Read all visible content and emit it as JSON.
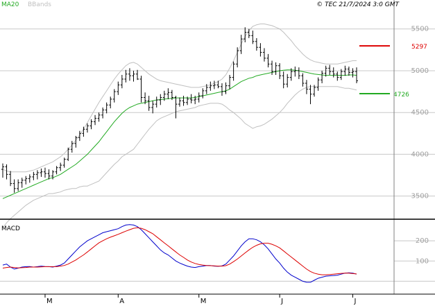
{
  "header": {
    "legend_ma": "MA20",
    "legend_bb": "BBands",
    "copyright": "© TEC 21/7/2024 3:0 GMT"
  },
  "colors": {
    "ma20": "#22aa22",
    "bbands": "#c0c0c0",
    "price_bars": "#000000",
    "macd": "#0000cc",
    "signal": "#dd0000",
    "resistance": "#dd0000",
    "support": "#22aa22",
    "grid": "#c8c8c8"
  },
  "levels": {
    "resistance": {
      "value": 5297,
      "label": "5297"
    },
    "support": {
      "value": 4726,
      "label": "4726"
    }
  },
  "macd_label": "MACD",
  "chart_data": [
    {
      "type": "ohlc",
      "panel": "price",
      "y_ticks": [
        3500,
        4000,
        4500,
        5000,
        5500
      ],
      "ylim": [
        3240,
        5730
      ],
      "x_ticks": [
        {
          "index": 11,
          "label": "M"
        },
        {
          "index": 30,
          "label": "A"
        },
        {
          "index": 51,
          "label": "M"
        },
        {
          "index": 72,
          "label": "J"
        },
        {
          "index": 91,
          "label": "J"
        }
      ],
      "ohlc": [
        [
          3820,
          3890,
          3720,
          3850
        ],
        [
          3850,
          3880,
          3700,
          3760
        ],
        [
          3760,
          3800,
          3620,
          3650
        ],
        [
          3650,
          3700,
          3540,
          3590
        ],
        [
          3590,
          3700,
          3560,
          3660
        ],
        [
          3660,
          3720,
          3600,
          3690
        ],
        [
          3690,
          3740,
          3640,
          3710
        ],
        [
          3710,
          3760,
          3660,
          3730
        ],
        [
          3730,
          3790,
          3690,
          3760
        ],
        [
          3760,
          3810,
          3700,
          3780
        ],
        [
          3780,
          3830,
          3730,
          3790
        ],
        [
          3790,
          3840,
          3720,
          3770
        ],
        [
          3770,
          3820,
          3700,
          3740
        ],
        [
          3740,
          3810,
          3700,
          3790
        ],
        [
          3790,
          3860,
          3760,
          3840
        ],
        [
          3840,
          3900,
          3800,
          3870
        ],
        [
          3870,
          3960,
          3840,
          3940
        ],
        [
          3940,
          4080,
          3920,
          4060
        ],
        [
          4060,
          4160,
          4020,
          4130
        ],
        [
          4130,
          4220,
          4080,
          4200
        ],
        [
          4200,
          4280,
          4160,
          4250
        ],
        [
          4250,
          4330,
          4210,
          4300
        ],
        [
          4300,
          4370,
          4260,
          4340
        ],
        [
          4340,
          4420,
          4300,
          4390
        ],
        [
          4390,
          4470,
          4350,
          4430
        ],
        [
          4430,
          4500,
          4390,
          4470
        ],
        [
          4470,
          4560,
          4430,
          4530
        ],
        [
          4530,
          4620,
          4490,
          4590
        ],
        [
          4590,
          4690,
          4550,
          4660
        ],
        [
          4660,
          4780,
          4620,
          4750
        ],
        [
          4750,
          4870,
          4710,
          4830
        ],
        [
          4830,
          4950,
          4790,
          4900
        ],
        [
          4900,
          5010,
          4860,
          4960
        ],
        [
          4960,
          5030,
          4880,
          4940
        ],
        [
          4940,
          5000,
          4870,
          4960
        ],
        [
          4960,
          5010,
          4890,
          4900
        ],
        [
          4900,
          4940,
          4620,
          4680
        ],
        [
          4680,
          4740,
          4600,
          4640
        ],
        [
          4640,
          4700,
          4520,
          4560
        ],
        [
          4560,
          4640,
          4490,
          4600
        ],
        [
          4600,
          4690,
          4560,
          4650
        ],
        [
          4650,
          4720,
          4590,
          4680
        ],
        [
          4680,
          4760,
          4640,
          4720
        ],
        [
          4720,
          4790,
          4660,
          4740
        ],
        [
          4740,
          4770,
          4650,
          4680
        ],
        [
          4680,
          4700,
          4430,
          4600
        ],
        [
          4600,
          4680,
          4570,
          4640
        ],
        [
          4640,
          4700,
          4580,
          4620
        ],
        [
          4620,
          4690,
          4590,
          4660
        ],
        [
          4660,
          4720,
          4610,
          4650
        ],
        [
          4650,
          4700,
          4600,
          4660
        ],
        [
          4660,
          4740,
          4620,
          4700
        ],
        [
          4700,
          4790,
          4670,
          4760
        ],
        [
          4760,
          4840,
          4720,
          4800
        ],
        [
          4800,
          4870,
          4760,
          4820
        ],
        [
          4820,
          4880,
          4780,
          4830
        ],
        [
          4830,
          4880,
          4790,
          4810
        ],
        [
          4810,
          4850,
          4700,
          4750
        ],
        [
          4750,
          4860,
          4720,
          4820
        ],
        [
          4820,
          4950,
          4780,
          4920
        ],
        [
          4920,
          5110,
          4880,
          5080
        ],
        [
          5080,
          5280,
          5040,
          5240
        ],
        [
          5240,
          5430,
          5200,
          5380
        ],
        [
          5380,
          5520,
          5340,
          5460
        ],
        [
          5460,
          5500,
          5390,
          5420
        ],
        [
          5420,
          5480,
          5320,
          5350
        ],
        [
          5350,
          5390,
          5240,
          5280
        ],
        [
          5280,
          5330,
          5170,
          5220
        ],
        [
          5220,
          5270,
          5110,
          5150
        ],
        [
          5150,
          5200,
          5040,
          5080
        ],
        [
          5080,
          5120,
          4950,
          4990
        ],
        [
          4990,
          5100,
          4950,
          5060
        ],
        [
          5060,
          5090,
          4900,
          4940
        ],
        [
          4940,
          4990,
          4790,
          4840
        ],
        [
          4840,
          4960,
          4800,
          4920
        ],
        [
          4920,
          5030,
          4880,
          4990
        ],
        [
          4990,
          5050,
          4930,
          5000
        ],
        [
          5000,
          5040,
          4900,
          4940
        ],
        [
          4940,
          4970,
          4810,
          4850
        ],
        [
          4850,
          4890,
          4720,
          4780
        ],
        [
          4780,
          4830,
          4600,
          4720
        ],
        [
          4720,
          4830,
          4690,
          4800
        ],
        [
          4800,
          4920,
          4760,
          4890
        ],
        [
          4890,
          5000,
          4850,
          4970
        ],
        [
          4970,
          5060,
          4930,
          5030
        ],
        [
          5030,
          5070,
          4950,
          4990
        ],
        [
          4990,
          5040,
          4920,
          4960
        ],
        [
          4960,
          4990,
          4880,
          4920
        ],
        [
          4920,
          5020,
          4890,
          4990
        ],
        [
          4990,
          5060,
          4940,
          5020
        ],
        [
          5020,
          5050,
          4940,
          4980
        ],
        [
          4980,
          5030,
          4920,
          4990
        ],
        [
          4990,
          5040,
          4850,
          4880
        ]
      ],
      "ma20": [
        3470,
        3490,
        3510,
        3530,
        3550,
        3570,
        3590,
        3610,
        3630,
        3650,
        3670,
        3690,
        3710,
        3720,
        3740,
        3760,
        3790,
        3820,
        3850,
        3880,
        3920,
        3960,
        4000,
        4050,
        4100,
        4150,
        4210,
        4270,
        4330,
        4390,
        4440,
        4490,
        4530,
        4560,
        4580,
        4600,
        4610,
        4620,
        4630,
        4640,
        4650,
        4655,
        4660,
        4665,
        4670,
        4675,
        4675,
        4675,
        4675,
        4675,
        4680,
        4690,
        4700,
        4710,
        4720,
        4730,
        4740,
        4750,
        4760,
        4780,
        4810,
        4840,
        4870,
        4890,
        4910,
        4920,
        4940,
        4950,
        4960,
        4970,
        4980,
        4990,
        5000,
        5005,
        5010,
        5010,
        5005,
        5000,
        4990,
        4980,
        4970,
        4960,
        4955,
        4950,
        4945,
        4945,
        4945,
        4945,
        4945,
        4945,
        4950,
        4950,
        4945
      ],
      "bb_upper": [
        3820,
        3800,
        3790,
        3790,
        3790,
        3790,
        3790,
        3800,
        3810,
        3830,
        3850,
        3870,
        3890,
        3910,
        3940,
        3970,
        4010,
        4060,
        4110,
        4170,
        4230,
        4300,
        4380,
        4460,
        4540,
        4620,
        4690,
        4760,
        4830,
        4900,
        4960,
        5010,
        5060,
        5090,
        5100,
        5080,
        5040,
        5000,
        4960,
        4930,
        4900,
        4880,
        4870,
        4860,
        4850,
        4840,
        4830,
        4820,
        4810,
        4800,
        4800,
        4800,
        4810,
        4820,
        4830,
        4850,
        4870,
        4900,
        4950,
        5030,
        5120,
        5220,
        5320,
        5410,
        5480,
        5530,
        5550,
        5560,
        5560,
        5550,
        5540,
        5520,
        5500,
        5460,
        5410,
        5360,
        5300,
        5250,
        5200,
        5160,
        5130,
        5110,
        5100,
        5090,
        5080,
        5080,
        5080,
        5080,
        5090,
        5100,
        5110,
        5120,
        5120
      ],
      "bb_lower": [
        3120,
        3180,
        3230,
        3270,
        3310,
        3350,
        3390,
        3420,
        3450,
        3470,
        3490,
        3510,
        3530,
        3530,
        3540,
        3550,
        3570,
        3580,
        3590,
        3590,
        3610,
        3620,
        3620,
        3640,
        3660,
        3680,
        3730,
        3780,
        3830,
        3880,
        3920,
        3970,
        4000,
        4030,
        4060,
        4120,
        4180,
        4240,
        4300,
        4350,
        4400,
        4430,
        4450,
        4470,
        4490,
        4510,
        4520,
        4530,
        4540,
        4550,
        4560,
        4580,
        4590,
        4600,
        4610,
        4610,
        4610,
        4600,
        4570,
        4530,
        4500,
        4460,
        4420,
        4370,
        4340,
        4310,
        4330,
        4340,
        4360,
        4390,
        4420,
        4460,
        4500,
        4550,
        4610,
        4660,
        4710,
        4750,
        4780,
        4800,
        4810,
        4810,
        4810,
        4810,
        4810,
        4810,
        4810,
        4810,
        4800,
        4790,
        4790,
        4780,
        4770
      ]
    },
    {
      "type": "line",
      "panel": "macd",
      "y_ticks": [
        100,
        200
      ],
      "ylim": [
        -50,
        300
      ],
      "series": [
        {
          "key": "macd",
          "values": [
            80,
            85,
            70,
            60,
            65,
            70,
            72,
            73,
            70,
            72,
            75,
            73,
            72,
            70,
            75,
            80,
            90,
            110,
            130,
            150,
            170,
            185,
            200,
            210,
            220,
            230,
            240,
            245,
            250,
            255,
            260,
            270,
            278,
            280,
            278,
            270,
            255,
            235,
            215,
            195,
            175,
            155,
            140,
            130,
            115,
            100,
            90,
            82,
            75,
            70,
            68,
            72,
            75,
            78,
            78,
            75,
            74,
            76,
            85,
            105,
            125,
            150,
            175,
            195,
            210,
            210,
            205,
            195,
            180,
            160,
            135,
            110,
            90,
            65,
            45,
            30,
            20,
            10,
            0,
            -5,
            -5,
            5,
            15,
            20,
            25,
            27,
            28,
            30,
            35,
            40,
            42,
            40,
            35
          ]
        },
        {
          "key": "signal",
          "values": [
            65,
            68,
            70,
            68,
            66,
            67,
            68,
            70,
            70,
            70,
            71,
            72,
            72,
            72,
            72,
            75,
            78,
            85,
            95,
            105,
            118,
            130,
            145,
            160,
            175,
            190,
            200,
            210,
            218,
            225,
            232,
            240,
            248,
            255,
            262,
            265,
            262,
            255,
            245,
            235,
            220,
            205,
            190,
            175,
            160,
            145,
            130,
            118,
            105,
            95,
            88,
            83,
            80,
            78,
            77,
            76,
            75,
            75,
            77,
            85,
            97,
            110,
            125,
            140,
            155,
            168,
            178,
            185,
            188,
            188,
            183,
            175,
            165,
            150,
            135,
            120,
            105,
            90,
            75,
            60,
            48,
            40,
            35,
            32,
            32,
            33,
            35,
            37,
            39,
            40,
            40,
            38,
            36
          ]
        }
      ]
    }
  ]
}
